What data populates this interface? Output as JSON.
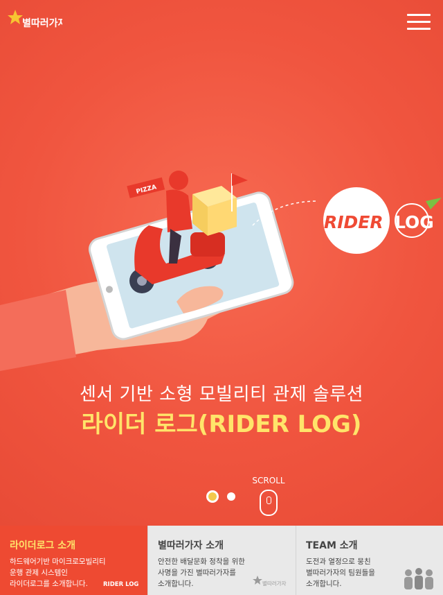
{
  "header": {
    "logo_text": "별따러가자",
    "menu_icon": "hamburger-menu-icon"
  },
  "hero": {
    "sub_title": "센서 기반 소형 모빌리티 관제 솔루션",
    "main_title": "라이더 로그(RIDER LOG)",
    "badge_text_rider": "RIDER",
    "badge_text_log": "LOG",
    "pizza_label": "PIZZA",
    "scroll_label": "SCROLL"
  },
  "slider": {
    "total": 2,
    "active": 1
  },
  "colors": {
    "background": "#f0553f",
    "accent_yellow": "#ffe46a",
    "panel_active": "#ee4a32",
    "panel_inactive": "#e9e9e9"
  },
  "panels": [
    {
      "title": "라이더로그 소개",
      "lines": [
        "하드웨어기반 마이크로모빌리티",
        "운행 관제 시스템인",
        "라이더로그를 소개합니다."
      ],
      "logo": "RIDER LOG"
    },
    {
      "title": "별따러가자 소개",
      "lines": [
        "안전한 배달문화 정착을 위한",
        "사명을 가진 별따러가자를",
        "소개합니다."
      ],
      "logo": "별따러가자"
    },
    {
      "title": "TEAM 소개",
      "lines": [
        "도전과 열정으로 뭉친",
        "별따러가자의 팀원들을",
        "소개합니다."
      ]
    }
  ]
}
